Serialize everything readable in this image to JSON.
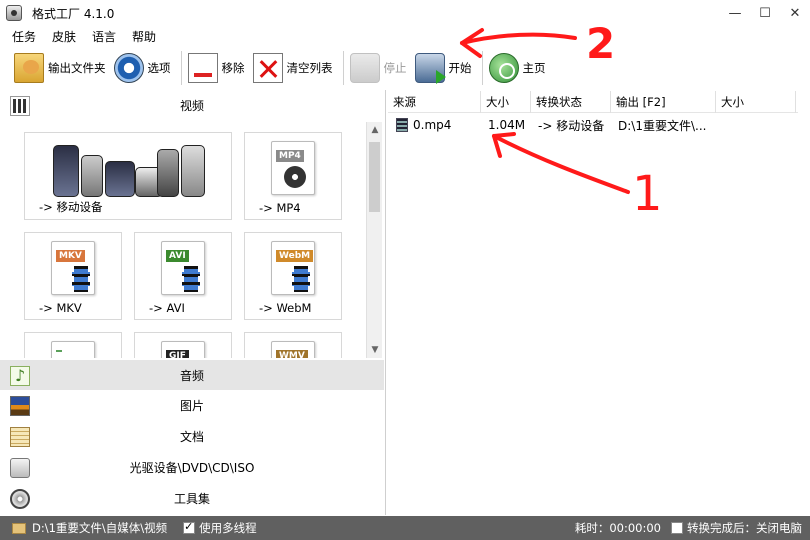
{
  "window": {
    "title": "格式工厂 4.1.0",
    "controls": {
      "minimize": "—",
      "maximize": "☐",
      "close": "✕"
    }
  },
  "menu": [
    "任务",
    "皮肤",
    "语言",
    "帮助"
  ],
  "toolbar": {
    "output_folder": "输出文件夹",
    "options": "选项",
    "remove": "移除",
    "clear_list": "清空列表",
    "stop": "停止",
    "start": "开始",
    "home": "主页"
  },
  "categories": {
    "video": "视频",
    "audio": "音频",
    "image": "图片",
    "document": "文档",
    "disc": "光驱设备\\DVD\\CD\\ISO",
    "tools": "工具集"
  },
  "video_tiles": {
    "mobile": "-> 移动设备",
    "mp4": "-> MP4",
    "mkv": "-> MKV",
    "avi": "-> AVI",
    "webm": "-> WebM",
    "formats": {
      "mp4": "MP4",
      "mkv": "MKV",
      "avi": "AVI",
      "webm": "WebM",
      "gif": "GIF",
      "wmv": "WMV"
    }
  },
  "task_list": {
    "columns": [
      "来源",
      "大小",
      "转换状态",
      "输出 [F2]",
      "大小"
    ],
    "rows": [
      {
        "source": "0.mp4",
        "size": "1.04M",
        "status": "-> 移动设备",
        "output": "D:\\1重要文件\\...",
        "out_size": ""
      }
    ]
  },
  "annotations": {
    "label_1": "1",
    "label_2": "2",
    "color": "#ff1a1a"
  },
  "statusbar": {
    "path": "D:\\1重要文件\\自媒体\\视频",
    "multithread": "使用多线程",
    "elapsed": "耗时：00:00:00",
    "after_convert": "转换完成后：关闭电脑",
    "multithread_checked": true
  },
  "colors": {
    "statusbar": "#606060",
    "selected_category": "#e5e5e5",
    "annotation": "#ff1a1a"
  }
}
